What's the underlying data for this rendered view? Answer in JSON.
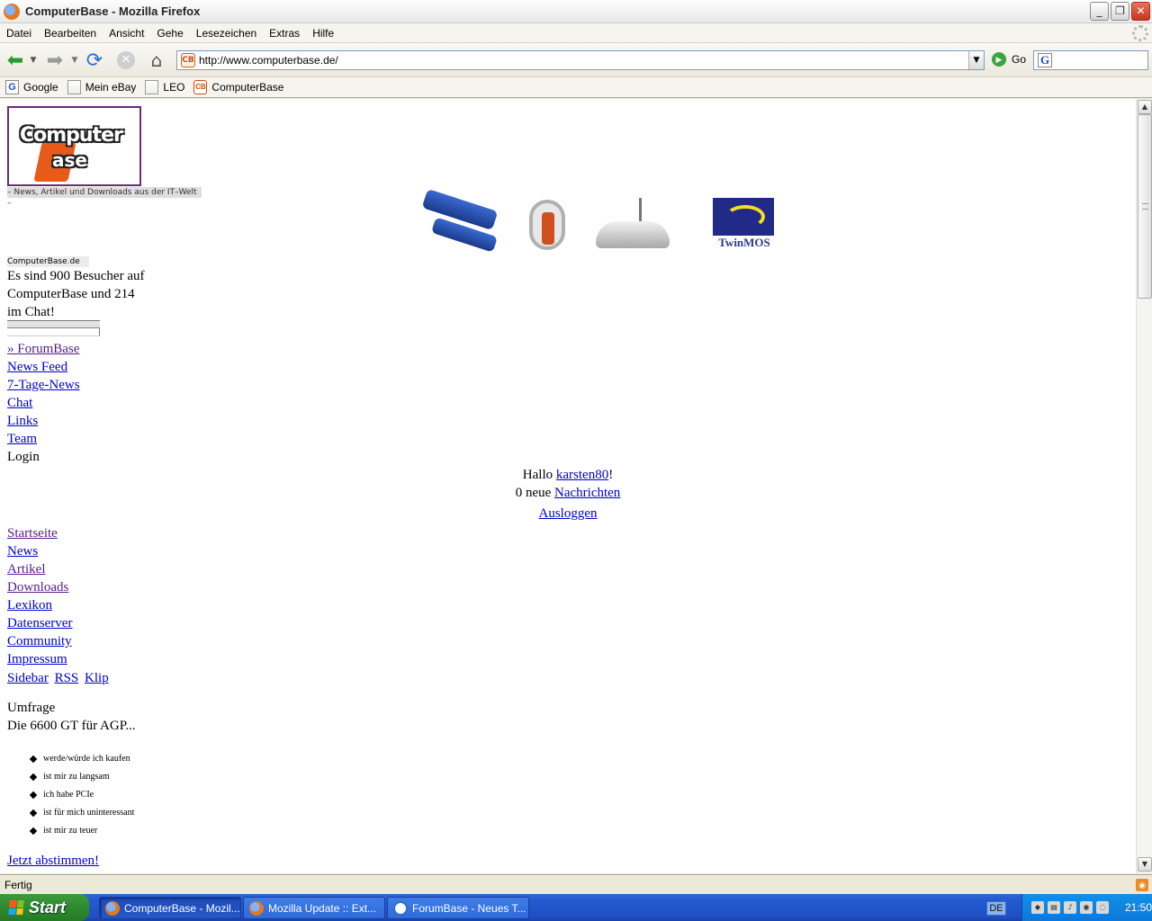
{
  "window": {
    "title": "ComputerBase - Mozilla Firefox",
    "minimize_glyph": "_",
    "restore_glyph": "❐",
    "close_glyph": "✕"
  },
  "menubar": {
    "items": [
      "Datei",
      "Bearbeiten",
      "Ansicht",
      "Gehe",
      "Lesezeichen",
      "Extras",
      "Hilfe"
    ]
  },
  "navbar": {
    "url": "http://www.computerbase.de/",
    "go_label": "Go",
    "search_placeholder": ""
  },
  "bookmarks": {
    "items": [
      {
        "label": "Google",
        "icon": "google-icon"
      },
      {
        "label": "Mein eBay",
        "icon": "page-icon"
      },
      {
        "label": "LEO",
        "icon": "page-icon"
      },
      {
        "label": "ComputerBase",
        "icon": "computerbase-icon"
      }
    ]
  },
  "page": {
    "logo_word1": "Computer",
    "logo_word2": "ase",
    "tagline": "– News, Artikel und Downloads aus der IT–Welt –",
    "banner_brand": "TwinMOS",
    "site_small_a": "ComputerBase",
    "site_small_b": "de",
    "visitors_text": "Es sind 900 Besucher auf ComputerBase und 214 im Chat!",
    "top_links": [
      "» ForumBase",
      "News Feed",
      "7-Tage-News",
      "Chat",
      "Links",
      "Team"
    ],
    "login_label": "Login",
    "greeting_prefix": "Hallo ",
    "username": "karsten80",
    "greeting_suffix": "!",
    "messages_prefix": "0 neue ",
    "messages_link": "Nachrichten",
    "logout": "Ausloggen",
    "main_links": [
      "Startseite",
      "News",
      "Artikel",
      "Downloads",
      "Lexikon",
      "Datenserver",
      "Community",
      "Impressum"
    ],
    "extra_links": [
      "Sidebar",
      "RSS",
      "Klip"
    ],
    "poll_title": "Umfrage",
    "poll_question": "Die 6600 GT für AGP...",
    "poll_options": [
      "werde/würde ich kaufen",
      "ist mir zu langsam",
      "ich habe PCIe",
      "ist für mich uninteressant",
      "ist mir zu teuer"
    ],
    "vote_link": "Jetzt abstimmen!"
  },
  "statusbar": {
    "text": "Fertig"
  },
  "taskbar": {
    "start_label": "Start",
    "tasks": [
      "ComputerBase - Mozil...",
      "Mozilla Update :: Ext...",
      "ForumBase - Neues T..."
    ],
    "language": "DE",
    "clock": "21:50"
  },
  "colors": {
    "link": "#0000cc",
    "visited_link": "#551a8b",
    "logo_border": "#6a2a7a",
    "logo_accent": "#e85a1a",
    "taskbar_blue": "#245bd0",
    "start_green": "#2e8a2e"
  }
}
